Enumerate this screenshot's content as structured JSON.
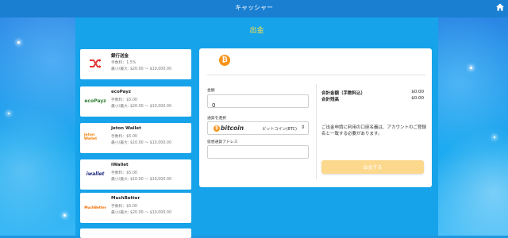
{
  "topbar": {
    "title": "キャッシャー"
  },
  "page": {
    "title": "出金"
  },
  "methods": [
    {
      "name": "銀行送金",
      "fee": "手数料：1.5%",
      "limit": "最小/最大: $20.00 ～ $10,000.00",
      "logo": "bank-transfer-icon"
    },
    {
      "name": "ecoPayz",
      "fee": "手数料：$5.00",
      "limit": "最小/最大: $20.00 ～ $10,000.00",
      "logo_text": "ecoPayz"
    },
    {
      "name": "Jeton Wallet",
      "fee": "手数料：$5.00",
      "limit": "最小/最大: $10.00 ～ $10,000.00",
      "logo_text": "Jeton Wallet"
    },
    {
      "name": "iWallet",
      "fee": "手数料：$5.00",
      "limit": "最小/最大: $10.00 ～ $10,000.00",
      "logo_text": "iwallet"
    },
    {
      "name": "MuchBetter",
      "fee": "手数料：$5.00",
      "limit": "最小/最大: $20.00 ～ $10,000.00",
      "logo_text": "MuchBetter"
    }
  ],
  "form": {
    "amount_label": "金額",
    "amount_value": "0",
    "currency_label": "通貨を選択",
    "currency_word": "bitcoin",
    "currency_option": "ビットコイン(BTC)",
    "address_label": "仮想通貨アドレス",
    "address_value": "",
    "total_label": "合計金額（手数料込）",
    "total_value": "$0.00",
    "balance_label": "合計残高",
    "balance_value": "$0.00",
    "notice": "ご出金申請に利用の口座名義は、アカウントのご登録名と一致する必要があります。",
    "submit_label": "出金する"
  },
  "colors": {
    "accent": "#ffe24a",
    "bitcoin": "#f7931a",
    "button": "#fcd88c"
  }
}
